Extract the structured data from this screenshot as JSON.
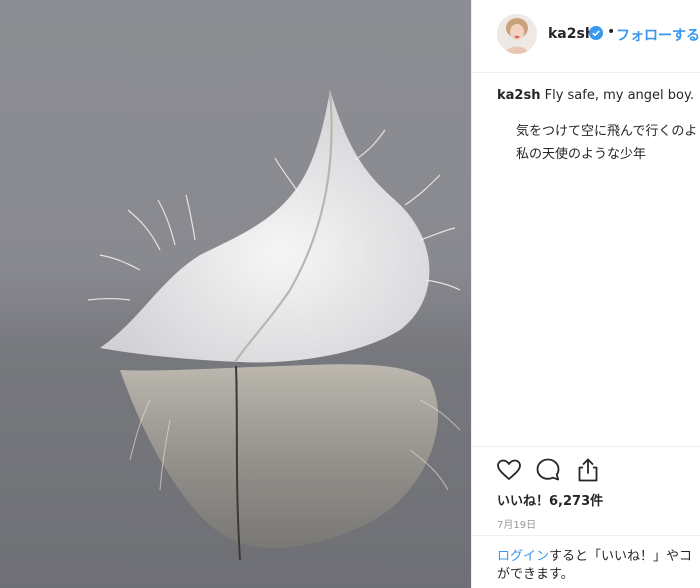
{
  "post": {
    "username": "ka2sh",
    "follow_label": "フォローする",
    "dot": "•",
    "caption": {
      "username": "ka2sh",
      "text": "Fly safe, my angel boy.",
      "line1": "気をつけて空に飛んで行くのよ",
      "line2": "私の天使のような少年"
    },
    "likes": "いいね！6,273件",
    "date": "7月19日",
    "login": {
      "link": "ログイン",
      "text1": "すると「いいね！」やコ",
      "text2": "ができます。"
    }
  },
  "icons": {
    "verified": "verified-badge-icon",
    "like": "heart-icon",
    "comment": "comment-bubble-icon",
    "share": "share-upload-icon"
  },
  "colors": {
    "link": "#3897f0",
    "text": "#262626",
    "muted": "#999999",
    "divider": "#efefef"
  }
}
